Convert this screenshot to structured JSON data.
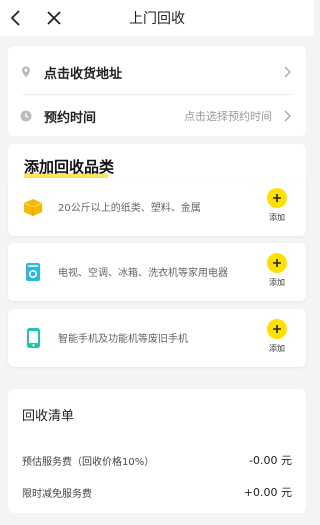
{
  "header": {
    "title": "上门回收"
  },
  "address_card": {
    "address_label": "点击收货地址",
    "time_label": "预约时间",
    "time_placeholder": "点击选择预约时间"
  },
  "categories": {
    "section_title": "添加回收品类",
    "items": [
      {
        "description": "20公斤以上的纸类、塑料、金属",
        "add_label": "添加",
        "icon": "box-icon"
      },
      {
        "description": "电视、空调、冰箱、洗衣机等家用电器",
        "add_label": "添加",
        "icon": "washing-machine-icon"
      },
      {
        "description": "智能手机及功能机等废旧手机",
        "add_label": "添加",
        "icon": "phone-icon"
      }
    ]
  },
  "recycle_list": {
    "title": "回收清单",
    "fees": [
      {
        "label": "预估服务费（回收价格10%）",
        "value": "-0.00 元"
      },
      {
        "label": "限时减免服务费",
        "value": "+0.00 元"
      }
    ]
  },
  "colors": {
    "accent_yellow": "#ffe000",
    "highlight_yellow": "#ffe45c",
    "box_icon": "#f5b800",
    "appliance_icon": "#2bb7e0",
    "phone_icon": "#22c4b0"
  }
}
